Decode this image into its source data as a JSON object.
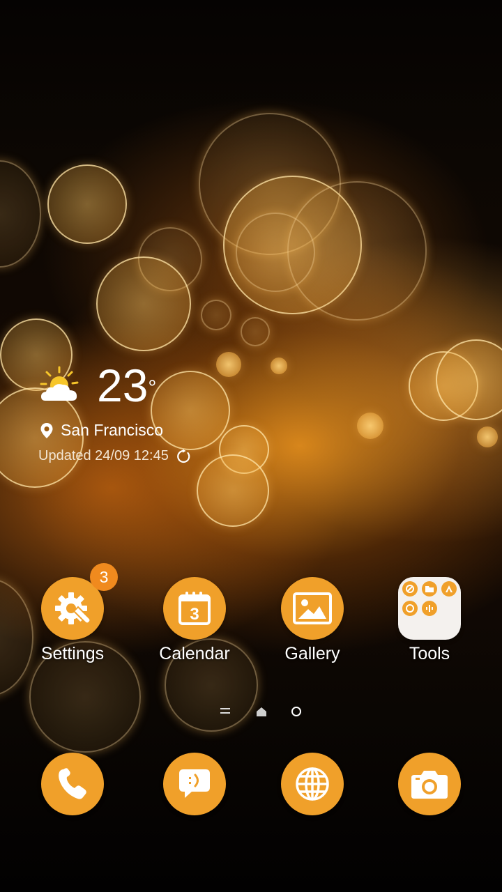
{
  "weather": {
    "temperature": "23",
    "degree_symbol": "°",
    "location": "San Francisco",
    "updated": "Updated 24/09 12:45",
    "condition_icon": "partly-sunny-icon"
  },
  "apps": [
    {
      "label": "Settings",
      "icon": "settings-gear-wrench-icon",
      "badge": "3"
    },
    {
      "label": "Calendar",
      "icon": "calendar-icon",
      "calendar_day": "3"
    },
    {
      "label": "Gallery",
      "icon": "gallery-icon"
    },
    {
      "label": "Tools",
      "icon": "folder-icon"
    }
  ],
  "dock": [
    {
      "icon": "phone-icon"
    },
    {
      "icon": "messages-icon"
    },
    {
      "icon": "browser-globe-icon"
    },
    {
      "icon": "camera-icon"
    }
  ],
  "page_indicator": {
    "pages": 3,
    "current": "home"
  },
  "colors": {
    "accent": "#f0a02a",
    "badge": "#f08a1e",
    "folder_bg": "#f4f1ee"
  }
}
